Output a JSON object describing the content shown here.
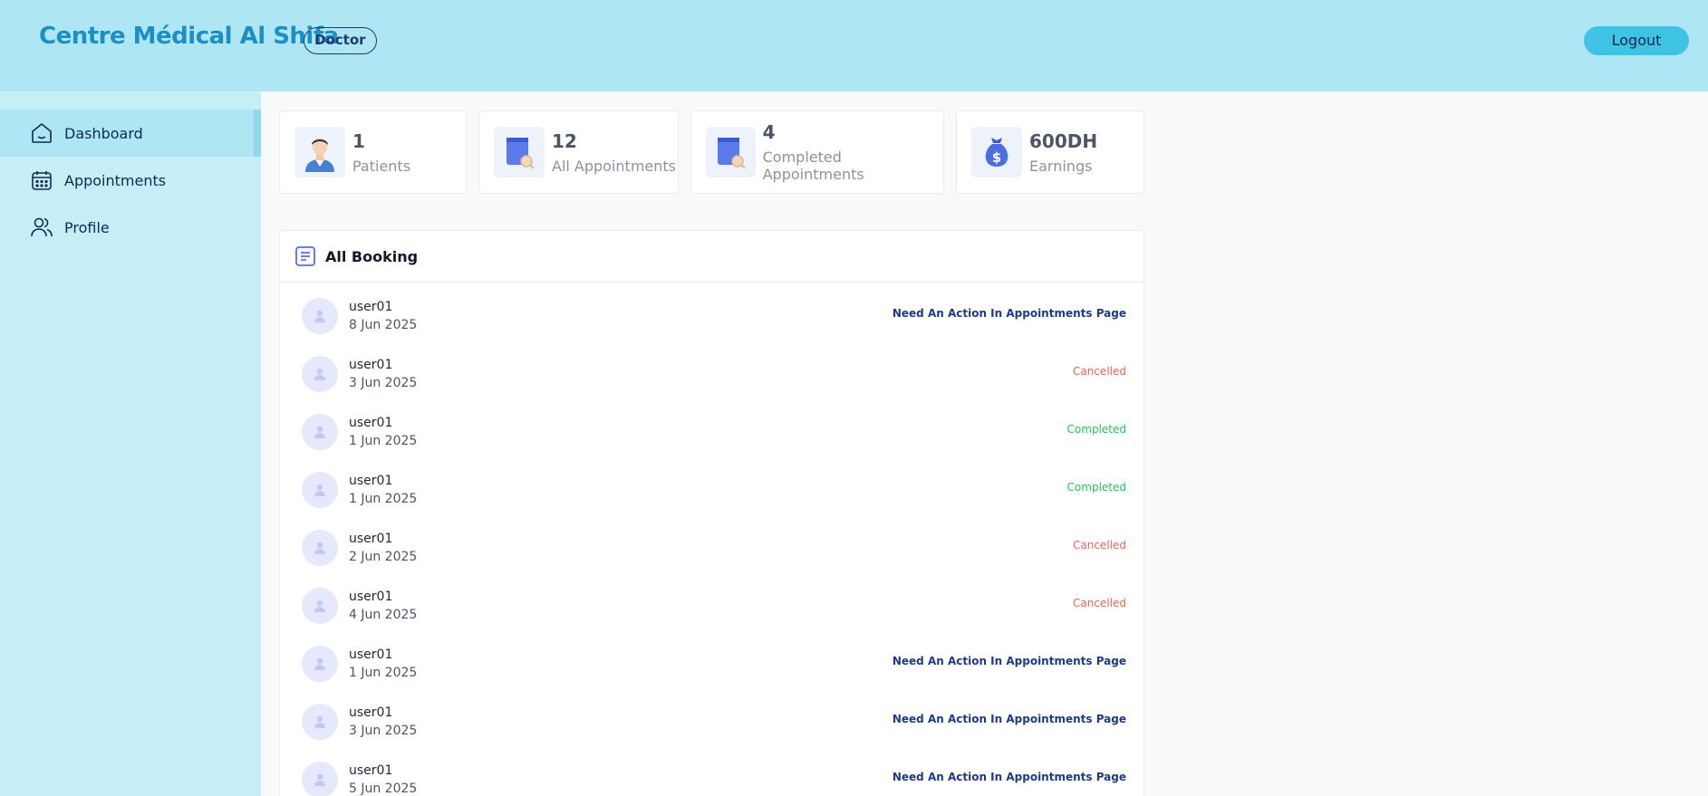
{
  "header": {
    "brand": "Centre Médical Al Shifa",
    "role": "Doctor",
    "logout_label": "Logout"
  },
  "sidebar": {
    "items": [
      {
        "label": "Dashboard",
        "icon": "home-icon",
        "active": true
      },
      {
        "label": "Appointments",
        "icon": "calendar-icon",
        "active": false
      },
      {
        "label": "Profile",
        "icon": "users-icon",
        "active": false
      }
    ]
  },
  "stats": [
    {
      "value": "1",
      "label": "Patients",
      "icon": "doctor-avatar-icon"
    },
    {
      "value": "12",
      "label": "All Appointments",
      "icon": "appointment-book-icon"
    },
    {
      "value": "4",
      "label": "Completed Appointments",
      "icon": "appointment-book-icon"
    },
    {
      "value": "600DH",
      "label": "Earnings",
      "icon": "money-bag-icon"
    }
  ],
  "bookings": {
    "title": "All Booking",
    "rows": [
      {
        "name": "user01",
        "date": "8 Jun 2025",
        "status": "Need An Action In Appointments Page",
        "status_type": "action"
      },
      {
        "name": "user01",
        "date": "3 Jun 2025",
        "status": "Cancelled",
        "status_type": "cancelled"
      },
      {
        "name": "user01",
        "date": "1 Jun 2025",
        "status": "Completed",
        "status_type": "completed"
      },
      {
        "name": "user01",
        "date": "1 Jun 2025",
        "status": "Completed",
        "status_type": "completed"
      },
      {
        "name": "user01",
        "date": "2 Jun 2025",
        "status": "Cancelled",
        "status_type": "cancelled"
      },
      {
        "name": "user01",
        "date": "4 Jun 2025",
        "status": "Cancelled",
        "status_type": "cancelled"
      },
      {
        "name": "user01",
        "date": "1 Jun 2025",
        "status": "Need An Action In Appointments Page",
        "status_type": "action"
      },
      {
        "name": "user01",
        "date": "3 Jun 2025",
        "status": "Need An Action In Appointments Page",
        "status_type": "action"
      },
      {
        "name": "user01",
        "date": "5 Jun 2025",
        "status": "Need An Action In Appointments Page",
        "status_type": "action"
      }
    ]
  },
  "colors": {
    "header_bg": "#aee6f3",
    "sidebar_bg": "#c6eef7",
    "brand": "#1b8fc6",
    "logout_bg": "#3ec3e4",
    "status_action": "#1e3a8a",
    "status_cancelled": "#f0635c",
    "status_completed": "#22c55e"
  }
}
